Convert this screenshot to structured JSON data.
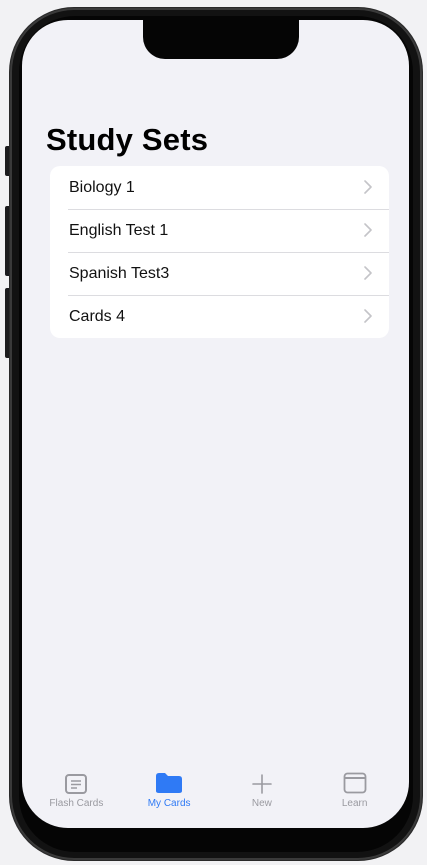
{
  "page": {
    "title": "Study Sets"
  },
  "study_sets": [
    {
      "label": "Biology 1"
    },
    {
      "label": "English Test 1"
    },
    {
      "label": "Spanish Test3"
    },
    {
      "label": "Cards 4"
    }
  ],
  "tab_bar": {
    "active_tab": "My Cards",
    "tabs": [
      {
        "label": "Flash Cards",
        "icon": "flash-cards-icon"
      },
      {
        "label": "My Cards",
        "icon": "folder-icon"
      },
      {
        "label": "New",
        "icon": "plus-icon"
      },
      {
        "label": "Learn",
        "icon": "window-icon"
      }
    ]
  },
  "colors": {
    "accent": "#2f7af5",
    "background": "#f2f2f7",
    "inactive_tab": "#9a9aa0",
    "chevron": "#c4c4c8"
  }
}
